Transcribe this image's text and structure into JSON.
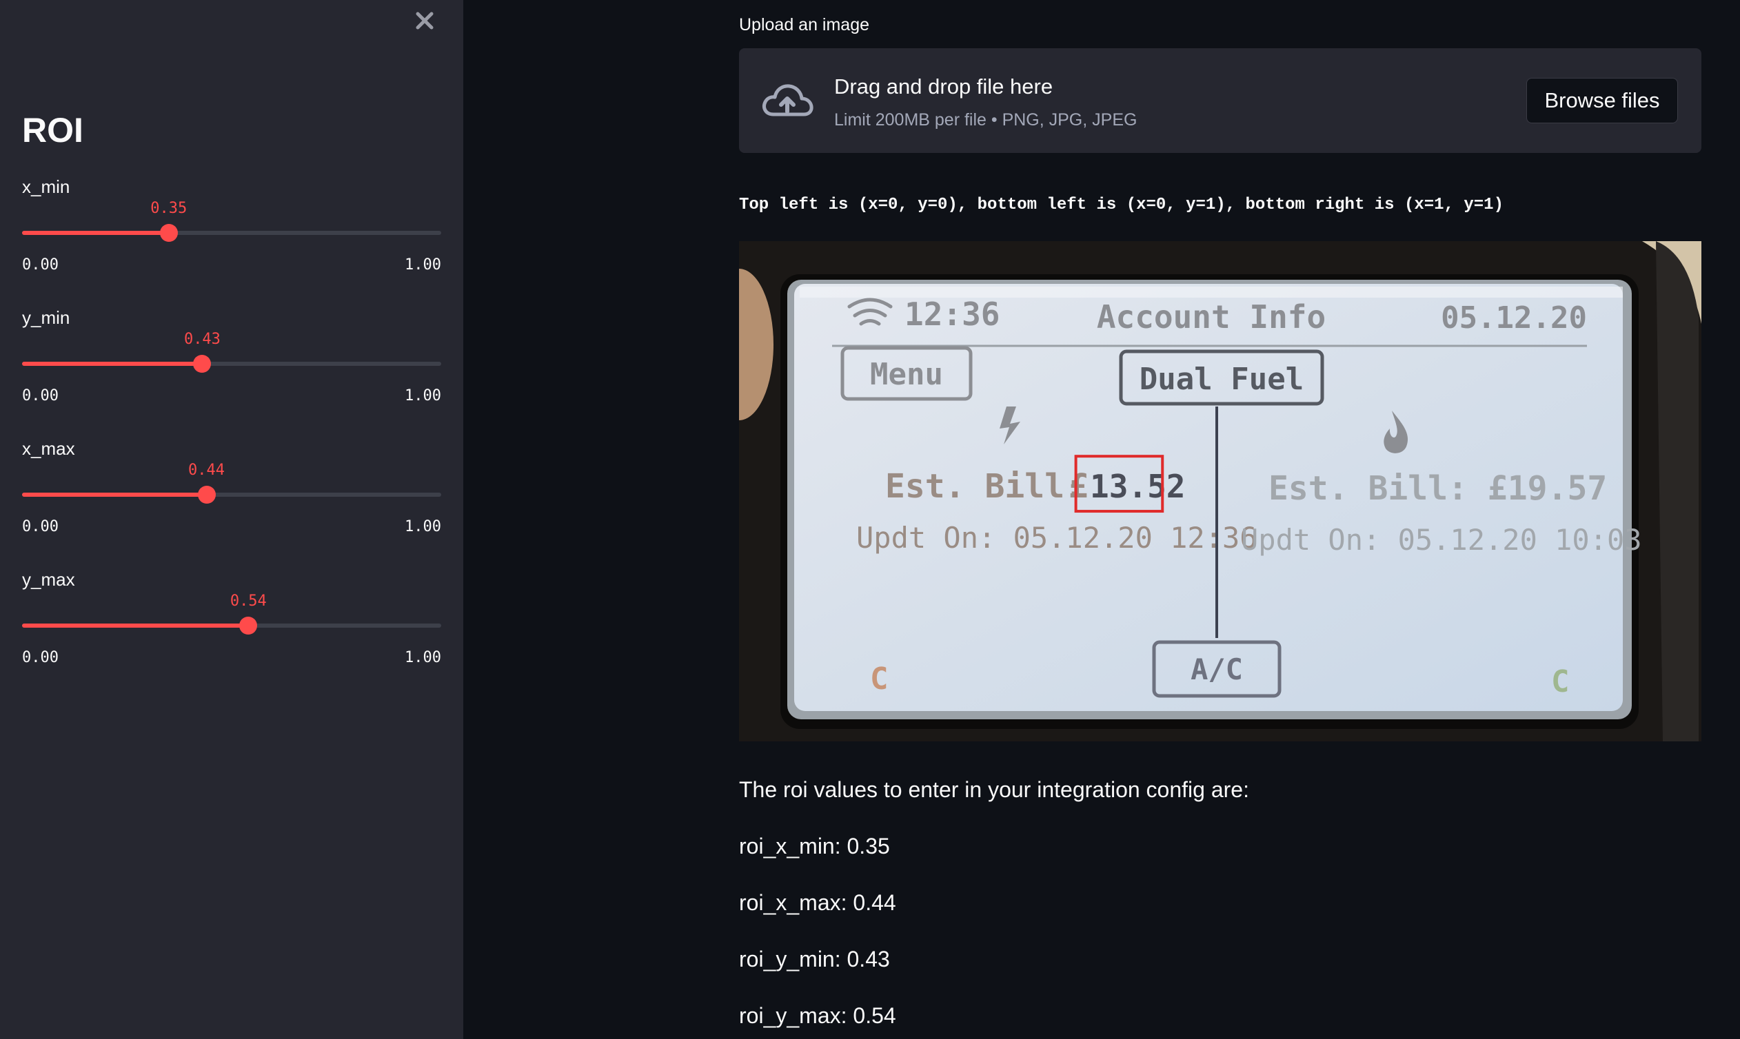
{
  "sidebar": {
    "title": "ROI",
    "close_label": "×",
    "sliders": [
      {
        "label": "x_min",
        "value": 0.35,
        "value_text": "0.35",
        "min": "0.00",
        "max": "1.00"
      },
      {
        "label": "y_min",
        "value": 0.43,
        "value_text": "0.43",
        "min": "0.00",
        "max": "1.00"
      },
      {
        "label": "x_max",
        "value": 0.44,
        "value_text": "0.44",
        "min": "0.00",
        "max": "1.00"
      },
      {
        "label": "y_max",
        "value": 0.54,
        "value_text": "0.54",
        "min": "0.00",
        "max": "1.00"
      }
    ]
  },
  "uploader": {
    "label": "Upload an image",
    "drop_title": "Drag and drop file here",
    "drop_subtitle": "Limit 200MB per file • PNG, JPG, JPEG",
    "browse_label": "Browse files",
    "icon": "cloud-upload-icon"
  },
  "coordinate_hint": "Top left is (x=0, y=0), bottom left is (x=0, y=1), bottom right is (x=1, y=1)",
  "display": {
    "time": "12:36",
    "title": "Account Info",
    "date": "05.12.20",
    "menu_label": "Menu",
    "fuel_label": "Dual Fuel",
    "left_bill_label": "Est. Bill:",
    "left_bill_currency": "£",
    "left_bill_value": "13.52",
    "left_updated": "Updt On: 05.12.20 12:36",
    "right_bill": "Est. Bill: £19.57",
    "right_updated": "Updt On: 05.12.20 10:03",
    "ac_label": "A/C",
    "left_status": "C",
    "right_status": "C"
  },
  "results": {
    "intro": "The roi values to enter in your integration config are:",
    "x_min": "roi_x_min: 0.35",
    "x_max": "roi_x_max: 0.44",
    "y_min": "roi_y_min: 0.43",
    "y_max": "roi_y_max: 0.54"
  },
  "colors": {
    "accent": "#ff4b4b",
    "background": "#0e1117",
    "sidebar": "#262730",
    "roi_box": "#e02b2b"
  }
}
